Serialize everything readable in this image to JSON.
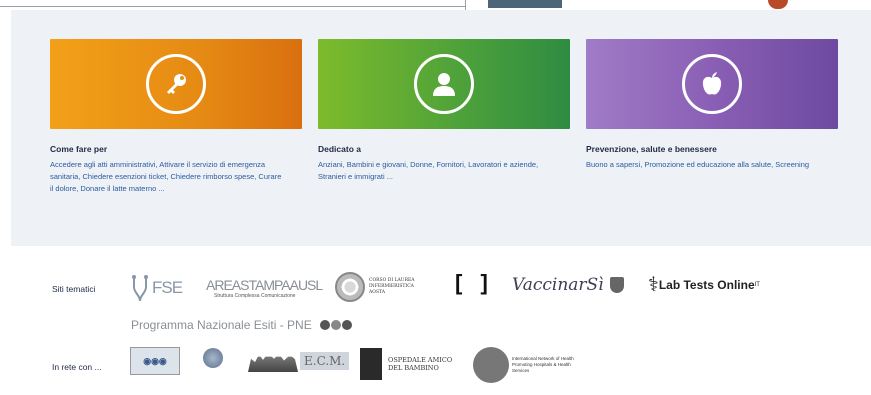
{
  "cards": [
    {
      "title": "Come fare per",
      "text": "Accedere agli atti amministrativi, Attivare il servizio di emergenza sanitaria, Chiedere esenzioni ticket, Chiedere rimborso spese, Curare il dolore, Donare il latte materno ...",
      "icon": "key-icon",
      "color": "#e58a14"
    },
    {
      "title": "Dedicato a",
      "text": "Anziani, Bambini e giovani, Donne, Fornitori, Lavoratori e aziende, Stranieri e immigrati ...",
      "icon": "person-icon",
      "color": "#4fa23a"
    },
    {
      "title": "Prevenzione, salute e benessere",
      "text": "Buono a sapersi, Promozione ed educazione alla salute, Screening",
      "icon": "apple-icon",
      "color": "#8a5fb5"
    }
  ],
  "footer": {
    "siti_label": "Siti tematici",
    "rete_label": "In rete con ...",
    "logos": {
      "fse": "FSE",
      "area_main": "AREASTAMPAAUSL",
      "area_sub": "Struttura Complessa Comunicazione",
      "corso": "CORSO DI LAUREA INFERMIERISTICA AOSTA",
      "vaccinarsi": "VaccinarSì",
      "labtests": "Lab Tests Online",
      "labtests_sup": "IT",
      "pne": "Programma Nazionale Esiti - PNE",
      "ecm": "E.C.M.",
      "ospedale": "OSPEDALE AMICO DEL BAMBINO",
      "hph": "International Network of Health Promoting Hospitals & Health Services"
    }
  }
}
